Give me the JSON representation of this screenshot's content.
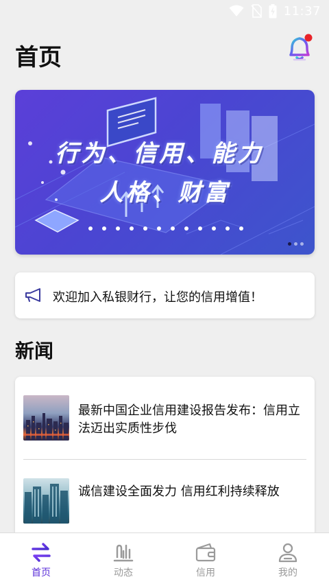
{
  "status_bar": {
    "time": "11:37"
  },
  "header": {
    "title": "首页"
  },
  "banner": {
    "line1": "行为、信用、能力",
    "line2": "人格、财富",
    "dot_count": 3,
    "active_dot": 0
  },
  "notice": {
    "text": "欢迎加入私银财行，让您的信用增值！",
    "icon": "megaphone-icon"
  },
  "news": {
    "section_title": "新闻",
    "items": [
      {
        "title": "最新中国企业信用建设报告发布：信用立法迈出实质性步伐"
      },
      {
        "title": "诚信建设全面发力 信用红利持续释放"
      }
    ]
  },
  "tabs": [
    {
      "label": "首页",
      "icon": "exchange-icon",
      "active": true
    },
    {
      "label": "动态",
      "icon": "chart-icon",
      "active": false
    },
    {
      "label": "信用",
      "icon": "wallet-icon",
      "active": false
    },
    {
      "label": "我的",
      "icon": "user-icon",
      "active": false
    }
  ],
  "colors": {
    "accent": "#5b2fd8",
    "inactive_tab": "#9a9a9a",
    "notification_dot": "#e8232a",
    "banner_start": "#5b3fd8",
    "banner_end": "#3d55cc"
  }
}
